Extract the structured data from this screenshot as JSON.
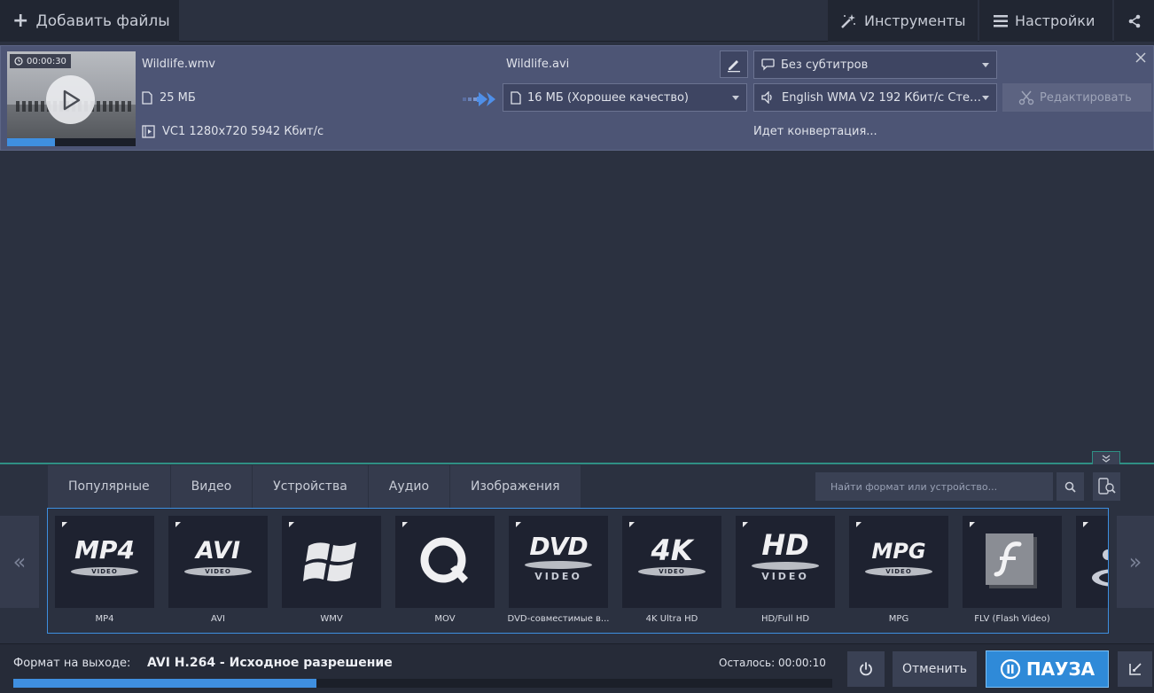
{
  "toolbar": {
    "add_files": "Добавить файлы",
    "tools": "Инструменты",
    "settings": "Настройки"
  },
  "file": {
    "duration": "00:00:30",
    "source_name": "Wildlife.wmv",
    "source_size": "25 МБ",
    "source_codec": "VC1 1280x720 5942 Кбит/с",
    "output_name": "Wildlife.avi",
    "output_quality": "16 МБ (Хорошее качество)",
    "subtitles": "Без субтитров",
    "audio": "English WMA V2 192 Кбит/с Сте…",
    "edit_label": "Редактировать",
    "status": "Идет конвертация...",
    "preview_progress": 0.37
  },
  "format_panel": {
    "tabs": [
      "Популярные",
      "Видео",
      "Устройства",
      "Аудио",
      "Изображения"
    ],
    "search_placeholder": "Найти формат или устройство...",
    "nav_prev": "«",
    "nav_next": "»",
    "tiles": [
      {
        "label": "MP4",
        "logo": "MP4",
        "sub": "VIDEO"
      },
      {
        "label": "AVI",
        "logo": "AVI",
        "sub": "VIDEO"
      },
      {
        "label": "WMV",
        "logo": "windows-logo"
      },
      {
        "label": "MOV",
        "logo": "quicktime-logo"
      },
      {
        "label": "DVD-совместимые в...",
        "logo": "DVD",
        "sub": "VIDEO"
      },
      {
        "label": "4K Ultra HD",
        "logo": "4K",
        "sub": "VIDEO"
      },
      {
        "label": "HD/Full HD",
        "logo": "HD",
        "sub": "VIDEO"
      },
      {
        "label": "MPG",
        "logo": "MPG",
        "sub": "VIDEO"
      },
      {
        "label": "FLV (Flash Video)",
        "logo": "flash-logo"
      }
    ]
  },
  "bottom": {
    "format_label": "Формат на выходе:",
    "format_value": "AVI H.264 - Исходное разрешение",
    "remaining_label": "Осталось:",
    "remaining_time": "00:00:10",
    "cancel": "Отменить",
    "pause": "ПАУЗА",
    "progress": 0.37
  },
  "colors": {
    "accent": "#2f8ad8",
    "progress": "#3f8fe0",
    "panel_divider": "#2f8f84"
  }
}
